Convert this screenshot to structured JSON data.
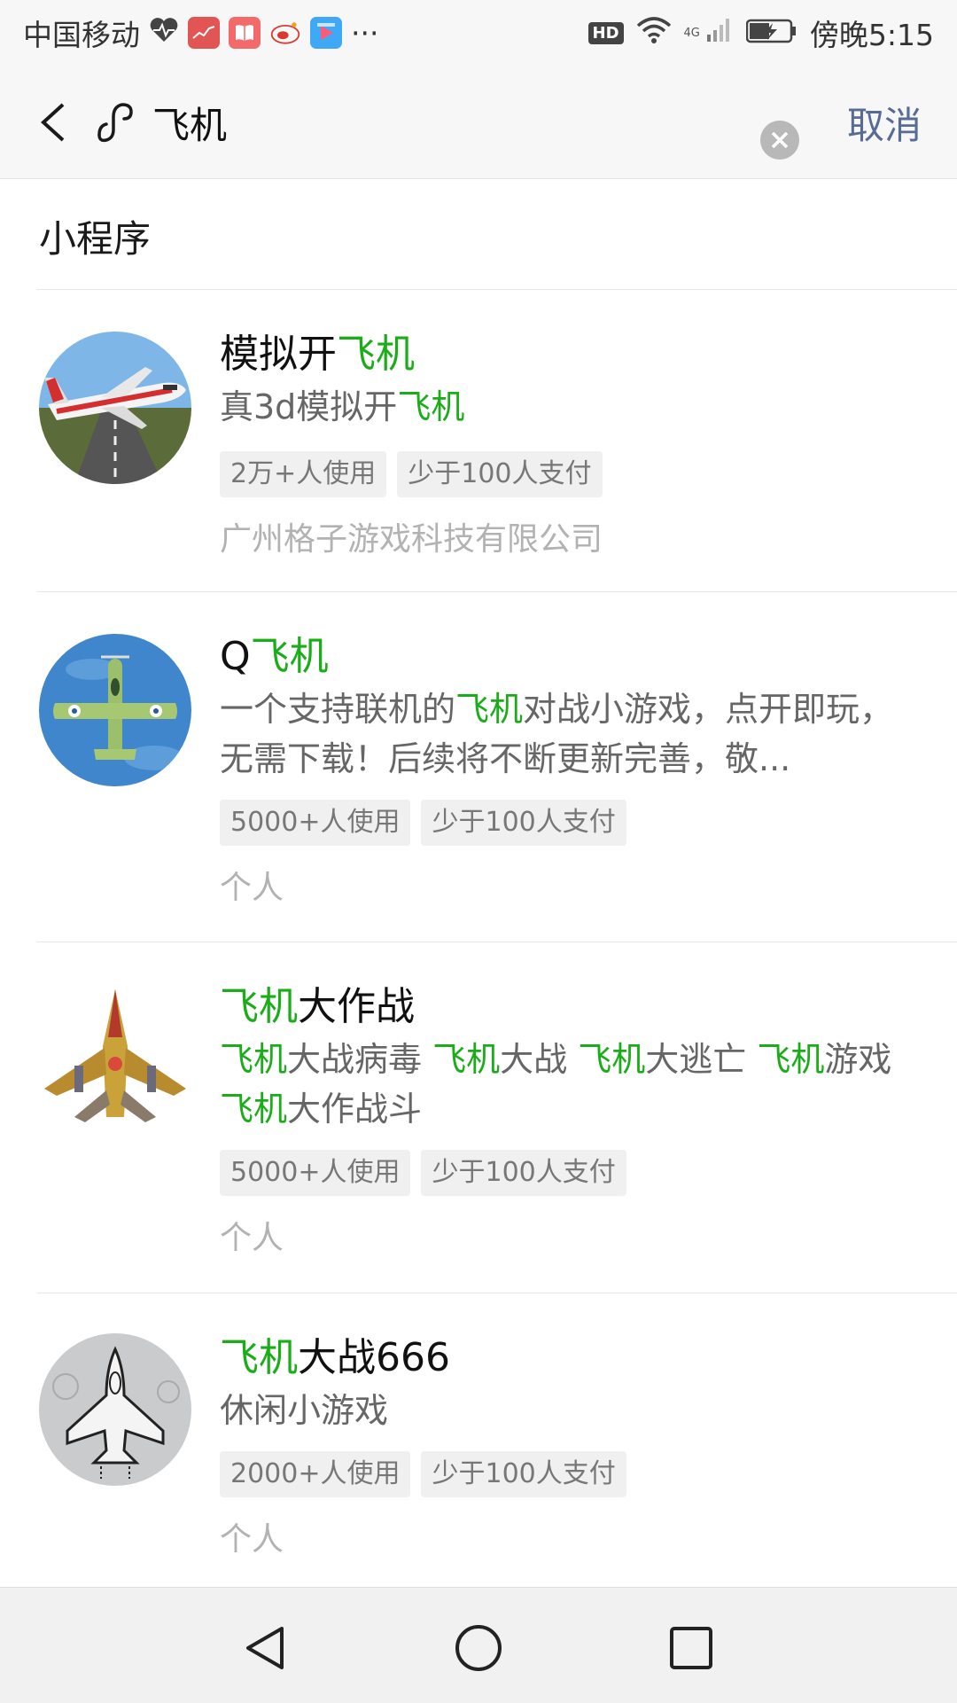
{
  "status_bar": {
    "carrier": "中国移动",
    "time": "傍晚5:15",
    "network": "4G",
    "icons": [
      "heart-rate-icon",
      "stock-app-icon",
      "book-app-icon",
      "weibo-app-icon",
      "shopping-app-icon",
      "more-icon",
      "hd-icon",
      "wifi-icon",
      "signal-icon",
      "battery-icon"
    ],
    "hd_label": "HD",
    "more": "···"
  },
  "search": {
    "query": "飞机",
    "cancel_label": "取消"
  },
  "section": {
    "title": "小程序"
  },
  "results": [
    {
      "title": [
        {
          "t": "模拟开"
        },
        {
          "t": "飞机",
          "hl": true
        }
      ],
      "desc": [
        {
          "t": "真3d模拟开"
        },
        {
          "t": "飞机",
          "hl": true
        }
      ],
      "tags": [
        "2万+人使用",
        "少于100人支付"
      ],
      "developer": "广州格子游戏科技有限公司",
      "icon": "airliner-icon"
    },
    {
      "title": [
        {
          "t": "Q"
        },
        {
          "t": "飞机",
          "hl": true
        }
      ],
      "desc": [
        {
          "t": "一个支持联机的"
        },
        {
          "t": "飞机",
          "hl": true
        },
        {
          "t": "对战小游戏，点开即玩，无需下载！后续将不断更新完善，敬..."
        }
      ],
      "tags": [
        "5000+人使用",
        "少于100人支付"
      ],
      "developer": "个人",
      "icon": "fighter-plane-icon"
    },
    {
      "title": [
        {
          "t": "飞机",
          "hl": true
        },
        {
          "t": "大作战"
        }
      ],
      "desc": [
        {
          "t": "飞机",
          "hl": true
        },
        {
          "t": "大战病毒 "
        },
        {
          "t": "飞机",
          "hl": true
        },
        {
          "t": "大战 "
        },
        {
          "t": "飞机",
          "hl": true
        },
        {
          "t": "大逃亡 "
        },
        {
          "t": "飞机",
          "hl": true
        },
        {
          "t": "游戏 "
        },
        {
          "t": "飞机",
          "hl": true
        },
        {
          "t": "大作战斗"
        }
      ],
      "tags": [
        "5000+人使用",
        "少于100人支付"
      ],
      "developer": "个人",
      "icon": "spaceship-icon"
    },
    {
      "title": [
        {
          "t": "飞机",
          "hl": true
        },
        {
          "t": "大战666"
        }
      ],
      "desc": [
        {
          "t": "休闲小游戏"
        }
      ],
      "tags": [
        "2000+人使用",
        "少于100人支付"
      ],
      "developer": "个人",
      "icon": "sketch-jet-icon"
    }
  ],
  "colors": {
    "highlight": "#1aad19",
    "link": "#576b95",
    "header_bg": "#f7f7f7",
    "tag_bg": "#f0f0f0"
  }
}
